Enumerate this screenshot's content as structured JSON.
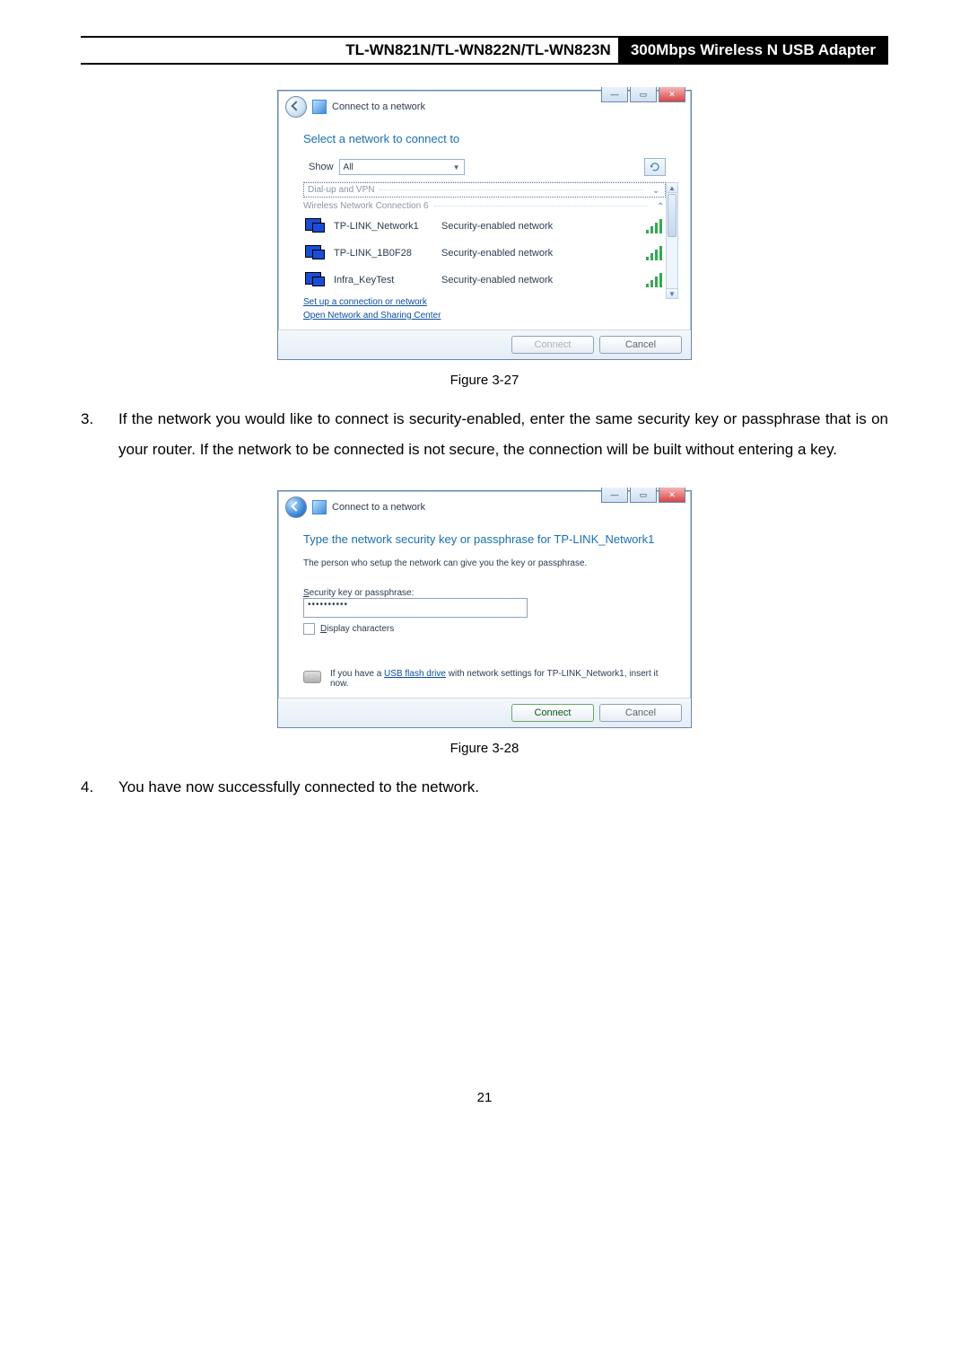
{
  "header": {
    "left": "TL-WN821N/TL-WN822N/TL-WN823N",
    "right": "300Mbps Wireless N USB Adapter"
  },
  "dialog1": {
    "title": "Connect to a network",
    "heading": "Select a network to connect to",
    "show_label": "Show",
    "show_value": "All",
    "group_dialup": "Dial-up and VPN",
    "group_wireless": "Wireless Network Connection 6",
    "networks": [
      {
        "name": "TP-LINK_Network1",
        "desc": "Security-enabled network"
      },
      {
        "name": "TP-LINK_1B0F28",
        "desc": "Security-enabled network"
      },
      {
        "name": "Infra_KeyTest",
        "desc": "Security-enabled network"
      }
    ],
    "link_setup": "Set up a connection or network",
    "link_center": "Open Network and Sharing Center",
    "btn_connect": "Connect",
    "btn_cancel": "Cancel"
  },
  "caption1": "Figure 3-27",
  "step3": {
    "num": "3.",
    "text": "If the network you would like to connect is security-enabled, enter the same security key or passphrase that is on your router. If the network to be connected is not secure, the connection will be built without entering a key."
  },
  "dialog2": {
    "title": "Connect to a network",
    "heading": "Type the network security key or passphrase for TP-LINK_Network1",
    "hint": "The person who setup the network can give you the key or passphrase.",
    "key_label": "Security key or passphrase:",
    "key_value": "••••••••••",
    "display_chars": "Display characters",
    "usb_pre": "If you have a ",
    "usb_link": "USB flash drive",
    "usb_post": " with network settings for TP-LINK_Network1, insert it now.",
    "btn_connect": "Connect",
    "btn_cancel": "Cancel"
  },
  "caption2": "Figure 3-28",
  "step4": {
    "num": "4.",
    "text": "You have now successfully connected to the network."
  },
  "page_number": "21"
}
